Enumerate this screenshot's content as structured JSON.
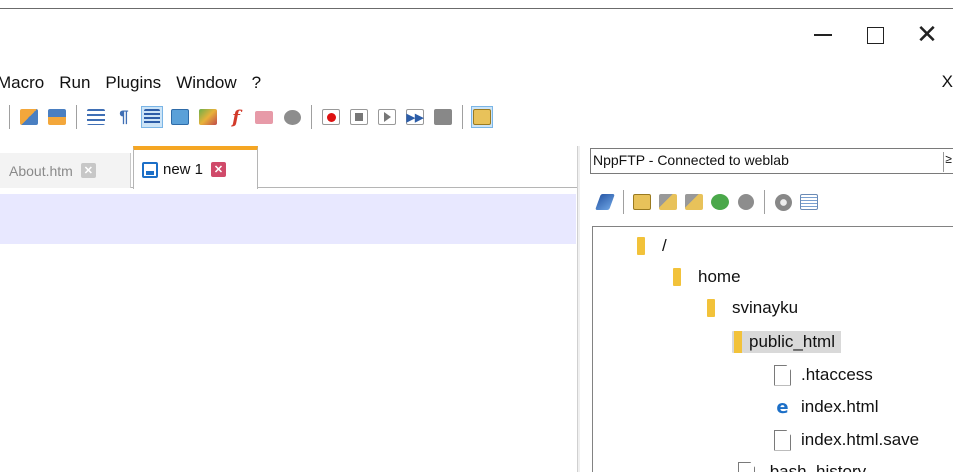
{
  "window": {
    "minimize_icon": "minimize-icon",
    "maximize_icon": "maximize-icon",
    "close_icon": "close-icon",
    "close_glyph": "✕"
  },
  "menu": {
    "items": [
      "Macro",
      "Run",
      "Plugins",
      "Window",
      "?"
    ],
    "close_label": "X"
  },
  "toolbar": {
    "icons": [
      "sync-vertical-icon",
      "sync-horizontal-icon",
      "word-wrap-icon",
      "show-all-characters-icon",
      "indent-guide-icon",
      "user-defined-language-icon",
      "document-map-icon",
      "function-list-icon",
      "folder-as-workspace-icon",
      "monitoring-icon",
      "record-macro-icon",
      "stop-recording-icon",
      "playback-macro-icon",
      "run-macro-multiple-icon",
      "save-macro-icon",
      "nppftp-show-icon"
    ],
    "accent_color": "#cce4f7"
  },
  "tabs": [
    {
      "label": "About.htm",
      "close_glyph": "✕",
      "active": false
    },
    {
      "label": "new 1",
      "close_glyph": "✕",
      "active": true
    }
  ],
  "tab_accent": "#f5a623",
  "ftp": {
    "title": "NppFTP - Connected to weblab",
    "title_button": "≥",
    "toolbar_icons": [
      "connect-icon",
      "download-icon",
      "upload-icon",
      "upload-alt-icon",
      "refresh-icon",
      "abort-icon",
      "settings-icon",
      "message-window-icon"
    ],
    "tree": [
      {
        "label": "/",
        "type": "folder",
        "depth": 0
      },
      {
        "label": "home",
        "type": "folder",
        "depth": 1
      },
      {
        "label": "svinayku",
        "type": "folder",
        "depth": 2
      },
      {
        "label": "public_html",
        "type": "folder",
        "depth": 3,
        "selected": true
      },
      {
        "label": ".htaccess",
        "type": "file",
        "depth": 4
      },
      {
        "label": "index.html",
        "type": "html",
        "depth": 4
      },
      {
        "label": "index.html.save",
        "type": "file",
        "depth": 4
      },
      {
        "label": ".bash_history",
        "type": "file",
        "depth": 3
      }
    ]
  }
}
